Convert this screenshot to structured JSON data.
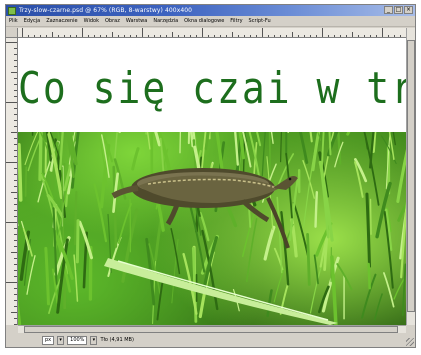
{
  "window": {
    "title": "Trzy-slow-czarne.psd @ 67% (RGB, 8-warstwy) 400x400",
    "controls": [
      "_",
      "□",
      "×"
    ]
  },
  "menu": {
    "items": [
      "Plik",
      "Edycja",
      "Zaznaczenie",
      "Widok",
      "Obraz",
      "Warstwa",
      "Narzędzia",
      "Okna dialogowe",
      "Filtry",
      "Script-Fu"
    ]
  },
  "canvas": {
    "headline": "Co się czai w trawie?"
  },
  "status": {
    "unit": "px",
    "zoom": "100%",
    "info": "Tło (4,91 MB)"
  },
  "colors": {
    "headline": "#1d6e1d",
    "title_bar": "#2a4fa8",
    "grass": "#4e9e22"
  }
}
